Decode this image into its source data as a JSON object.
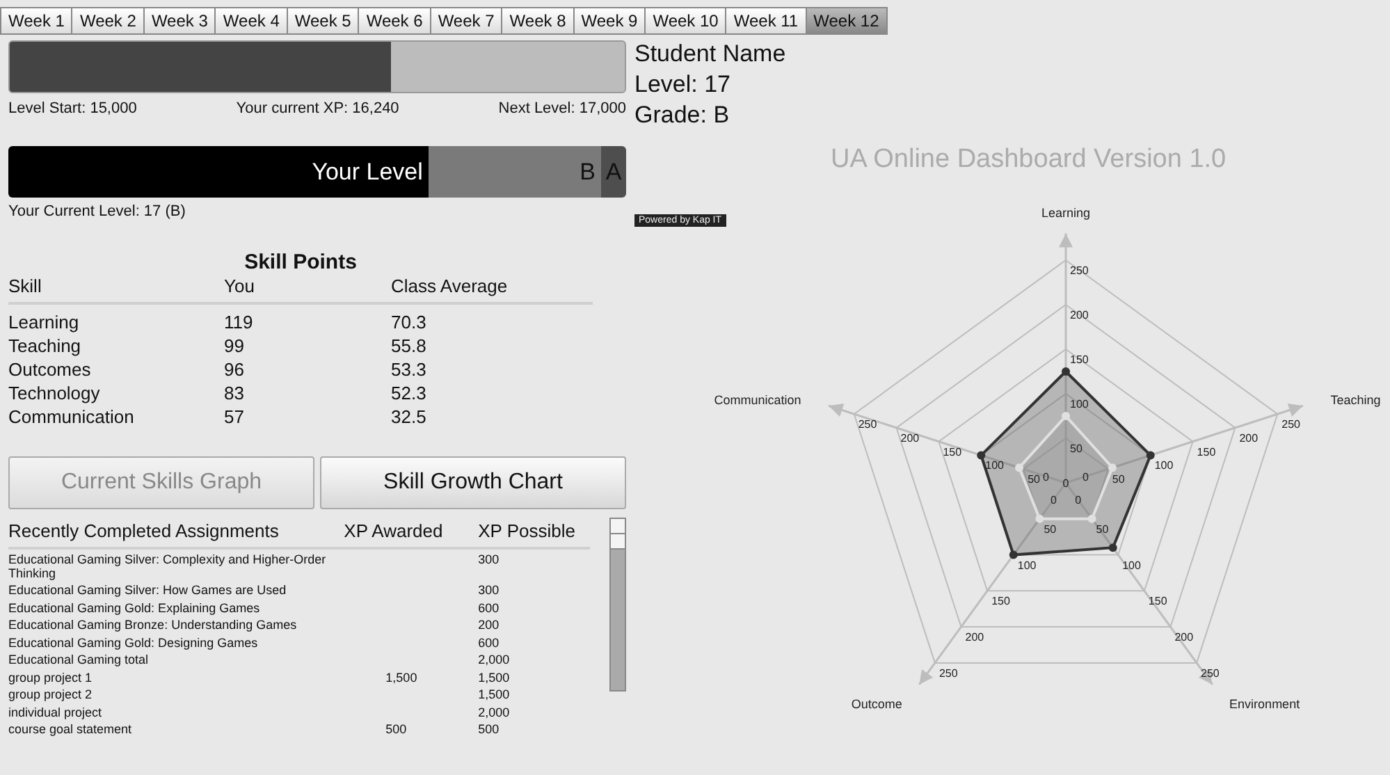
{
  "tabs": [
    {
      "label": "Week 1",
      "selected": false
    },
    {
      "label": "Week 2",
      "selected": false
    },
    {
      "label": "Week 3",
      "selected": false
    },
    {
      "label": "Week 4",
      "selected": false
    },
    {
      "label": "Week 5",
      "selected": false
    },
    {
      "label": "Week 6",
      "selected": false
    },
    {
      "label": "Week 7",
      "selected": false
    },
    {
      "label": "Week 8",
      "selected": false
    },
    {
      "label": "Week 9",
      "selected": false
    },
    {
      "label": "Week 10",
      "selected": false
    },
    {
      "label": "Week 11",
      "selected": false
    },
    {
      "label": "Week 12",
      "selected": true
    }
  ],
  "xp_bar": {
    "level": 0.62,
    "start_label": "Level Start: 15,000",
    "current_label": "Your current XP: 16,240",
    "next_label": "Next Level: 17,000"
  },
  "level_bar": {
    "label": "Your Level",
    "grades": [
      {
        "label": "B",
        "color": "#7a7a7a"
      },
      {
        "label": "A",
        "color": "#4e4e4e"
      }
    ],
    "caption": "Your Current Level: 17 (B)"
  },
  "student": {
    "name": "Student Name",
    "level": "Level: 17",
    "grade": "Grade: B"
  },
  "title": "UA Online Dashboard Version 1.0",
  "powered_by": "Powered by Kap IT",
  "skill_points": {
    "title": "Skill Points",
    "columns": [
      "Skill",
      "You",
      "Class Average"
    ],
    "rows": [
      [
        "Learning",
        "119",
        "70.3"
      ],
      [
        "Teaching",
        "99",
        "55.8"
      ],
      [
        "Outcomes",
        "96",
        "53.3"
      ],
      [
        "Technology",
        "83",
        "52.3"
      ],
      [
        "Communication",
        "57",
        "32.5"
      ]
    ]
  },
  "buttons": [
    {
      "label": "Current Skills Graph",
      "selected": true
    },
    {
      "label": "Skill Growth Chart",
      "selected": false
    }
  ],
  "assignments": {
    "columns": [
      "Recently Completed Assignments",
      "XP Awarded",
      "XP Possible"
    ],
    "rows": [
      [
        "Educational Gaming Silver: Complexity and Higher-Order Thinking",
        "",
        "300"
      ],
      [
        "Educational Gaming Silver: How Games are Used",
        "",
        "300"
      ],
      [
        "Educational Gaming Gold: Explaining Games",
        "",
        "600"
      ],
      [
        "Educational Gaming Bronze: Understanding Games",
        "",
        "200"
      ],
      [
        "Educational Gaming Gold: Designing Games",
        "",
        "600"
      ],
      [
        "Educational Gaming total",
        "",
        "2,000"
      ],
      [
        "group project 1",
        "1,500",
        "1,500"
      ],
      [
        "group project 2",
        "",
        "1,500"
      ],
      [
        "individual project",
        "",
        "2,000"
      ],
      [
        "course goal statement",
        "500",
        "500"
      ]
    ]
  },
  "radar": {
    "chart_data": {
      "type": "radar",
      "categories": [
        "Learning",
        "Teaching",
        "Environment",
        "Outcome",
        "Communication"
      ],
      "yticks": [
        0,
        50,
        100,
        150,
        200,
        250
      ],
      "ylim": [
        0,
        250
      ],
      "series": [
        {
          "color": "#333333",
          "values": [
            125,
            100,
            90,
            100,
            100
          ]
        },
        {
          "color": "#e0e0e0",
          "values": [
            75,
            55,
            50,
            50,
            55
          ]
        }
      ]
    },
    "spoke_tick_labels": [
      [
        "250",
        "200",
        "150",
        "100",
        "50",
        "0"
      ],
      [
        "0",
        "50",
        "100",
        "150",
        "200",
        "250"
      ],
      [
        "250",
        "200",
        "150",
        "100",
        "50",
        "0"
      ],
      [
        "250",
        "200",
        "150",
        "100",
        "50",
        "0"
      ],
      [
        "0",
        "50",
        "100",
        "150",
        "200",
        "250"
      ]
    ]
  }
}
